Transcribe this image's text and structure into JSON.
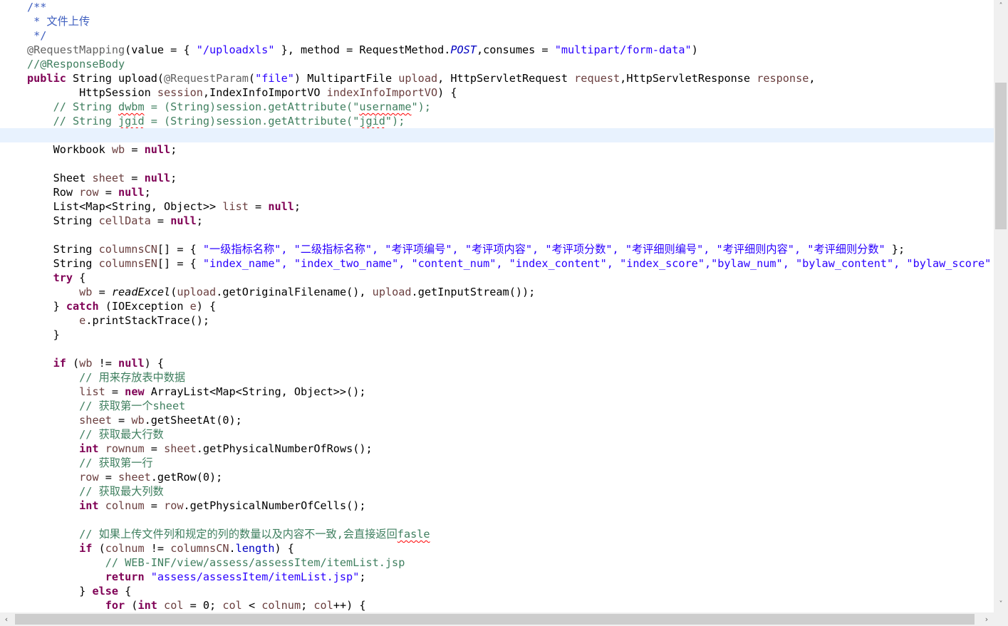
{
  "code": {
    "l1": "/**",
    "l2": " * 文件上传",
    "l3": " */",
    "l4_ann": "@RequestMapping",
    "l4_a": "(value = { ",
    "l4_s1": "\"/uploadxls\"",
    "l4_b": " }, method = RequestMethod.",
    "l4_post": "POST",
    "l4_c": ",consumes = ",
    "l4_s2": "\"multipart/form-data\"",
    "l4_d": ")",
    "l5": "//@ResponseBody",
    "l6_kw": "public",
    "l6_a": " String upload(",
    "l6_ann": "@RequestParam",
    "l6_b": "(",
    "l6_s": "\"file\"",
    "l6_c": ") MultipartFile ",
    "l6_v1": "upload",
    "l6_d": ", HttpServletRequest ",
    "l6_v2": "request",
    "l6_e": ",HttpServletResponse ",
    "l6_v3": "response",
    "l6_f": ",",
    "l7_indent": "        ",
    "l7_a": "HttpSession ",
    "l7_v1": "session",
    "l7_b": ",IndexInfoImportVO ",
    "l7_v2": "indexInfoImportVO",
    "l7_c": ") {",
    "l8_a": "    // String ",
    "l8_sq1": "dwbm",
    "l8_b": " = (String)session.getAttribute(\"",
    "l8_sq2": "username",
    "l8_c": "\");",
    "l9_a": "    // String ",
    "l9_sq1": "jgid",
    "l9_b": " = (String)session.getAttribute(\"",
    "l9_sq2": "jgid",
    "l9_c": "\");",
    "l11_a": "    Workbook ",
    "l11_v": "wb",
    "l11_b": " = ",
    "l11_kw": "null",
    "l11_c": ";",
    "l13_a": "    Sheet ",
    "l13_v": "sheet",
    "l13_b": " = ",
    "l13_kw": "null",
    "l13_c": ";",
    "l14_a": "    Row ",
    "l14_v": "row",
    "l14_b": " = ",
    "l14_kw": "null",
    "l14_c": ";",
    "l15_a": "    List<Map<String, Object>> ",
    "l15_v": "list",
    "l15_b": " = ",
    "l15_kw": "null",
    "l15_c": ";",
    "l16_a": "    String ",
    "l16_v": "cellData",
    "l16_b": " = ",
    "l16_kw": "null",
    "l16_c": ";",
    "l18_a": "    String ",
    "l18_v": "columnsCN",
    "l18_b": "[] = { ",
    "l18_s": "\"一级指标名称\", \"二级指标名称\", \"考评项编号\", \"考评项内容\", \"考评项分数\", \"考评细则编号\", \"考评细则内容\", \"考评细则分数\"",
    "l18_c": " };",
    "l19_a": "    String ",
    "l19_v": "columnsEN",
    "l19_b": "[] = { ",
    "l19_s": "\"index_name\", \"index_two_name\", \"content_num\", \"index_content\", \"index_score\",\"bylaw_num\", \"bylaw_content\", \"bylaw_score\"",
    "l19_c": " };",
    "l20_kw": "    try",
    "l20_a": " {",
    "l21_a": "        ",
    "l21_v1": "wb",
    "l21_b": " = ",
    "l21_m": "readExcel",
    "l21_c": "(",
    "l21_v2": "upload",
    "l21_d": ".getOriginalFilename(), ",
    "l21_v3": "upload",
    "l21_e": ".getInputStream());",
    "l22_a": "    } ",
    "l22_kw": "catch",
    "l22_b": " (IOException ",
    "l22_v": "e",
    "l22_c": ") {",
    "l23_a": "        ",
    "l23_v": "e",
    "l23_b": ".printStackTrace();",
    "l24": "    }",
    "l26_kw": "    if",
    "l26_a": " (",
    "l26_v": "wb",
    "l26_b": " != ",
    "l26_kw2": "null",
    "l26_c": ") {",
    "l27": "        // 用来存放表中数据",
    "l28_a": "        ",
    "l28_v": "list",
    "l28_b": " = ",
    "l28_kw": "new",
    "l28_c": " ArrayList<Map<String, Object>>();",
    "l29": "        // 获取第一个sheet",
    "l30_a": "        ",
    "l30_v1": "sheet",
    "l30_b": " = ",
    "l30_v2": "wb",
    "l30_c": ".getSheetAt(0);",
    "l31": "        // 获取最大行数",
    "l32_kw": "        int",
    "l32_a": " ",
    "l32_v1": "rownum",
    "l32_b": " = ",
    "l32_v2": "sheet",
    "l32_c": ".getPhysicalNumberOfRows();",
    "l33": "        // 获取第一行",
    "l34_a": "        ",
    "l34_v1": "row",
    "l34_b": " = ",
    "l34_v2": "sheet",
    "l34_c": ".getRow(0);",
    "l35": "        // 获取最大列数",
    "l36_kw": "        int",
    "l36_a": " ",
    "l36_v1": "colnum",
    "l36_b": " = ",
    "l36_v2": "row",
    "l36_c": ".getPhysicalNumberOfCells();",
    "l38_a": "        // 如果上传文件列和规定的列的数量以及内容不一致,会直接返回",
    "l38_sq": "fasle",
    "l39_kw": "        if",
    "l39_a": " (",
    "l39_v1": "colnum",
    "l39_b": " != ",
    "l39_v2": "columnsCN",
    "l39_c": ".",
    "l39_f": "length",
    "l39_d": ") {",
    "l40": "            // WEB-INF/view/assess/assessItem/itemList.jsp",
    "l41_kw": "            return",
    "l41_a": " ",
    "l41_s": "\"assess/assessItem/itemList.jsp\"",
    "l41_b": ";",
    "l42_a": "        } ",
    "l42_kw": "else",
    "l42_b": " {",
    "l43_kw": "            for",
    "l43_a": " (",
    "l43_kw2": "int",
    "l43_b": " ",
    "l43_v1": "col",
    "l43_c": " = 0; ",
    "l43_v2": "col",
    "l43_d": " < ",
    "l43_v3": "colnum",
    "l43_e": "; ",
    "l43_v4": "col",
    "l43_f": "++) {"
  },
  "scrollbars": {
    "up_arrow": "˄",
    "down_arrow": "˅",
    "left_arrow": "‹",
    "right_arrow": "›"
  },
  "colors": {
    "keyword": "#7f0055",
    "string": "#2a00ff",
    "comment": "#3f7f5f",
    "javadoc": "#3f5fbf",
    "annotation": "#646464",
    "local_variable": "#6a3e3e",
    "field": "#0000c0",
    "current_line": "#e8f2fe"
  }
}
